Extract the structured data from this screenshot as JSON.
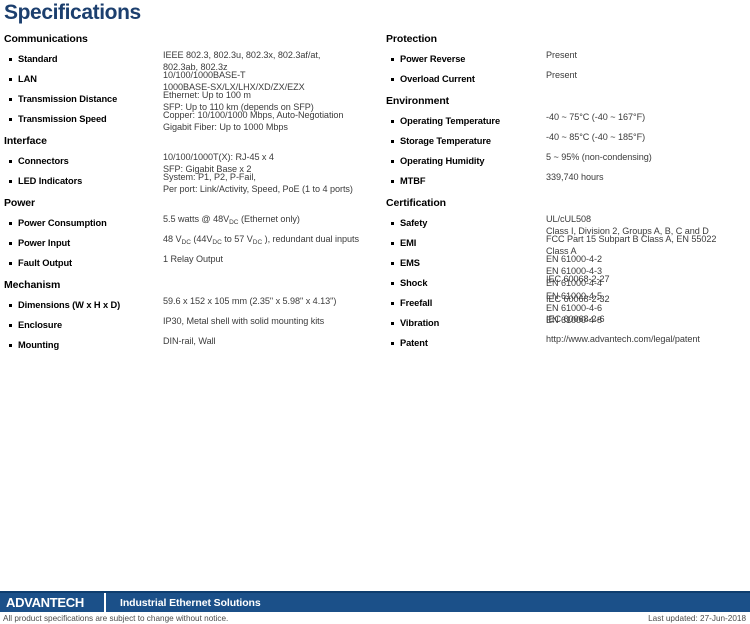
{
  "page": {
    "title": "Specifications"
  },
  "left_column": [
    {
      "title": "Communications",
      "rows": [
        {
          "label": "Standard",
          "value": "IEEE 802.3, 802.3u, 802.3x, 802.3af/at,\n802.3ab, 802.3z"
        },
        {
          "label": "LAN",
          "value": "10/100/1000BASE-T\n1000BASE-SX/LX/LHX/XD/ZX/EZX"
        },
        {
          "label": "Transmission Distance",
          "value": "Ethernet: Up to 100 m\nSFP: Up to 110 km (depends on SFP)"
        },
        {
          "label": "Transmission Speed",
          "value": "Copper: 10/100/1000 Mbps, Auto-Negotiation\nGigabit Fiber: Up to 1000 Mbps"
        }
      ]
    },
    {
      "title": "Interface",
      "rows": [
        {
          "label": "Connectors",
          "value": "10/100/1000T(X): RJ-45 x 4\nSFP: Gigabit Base x 2"
        },
        {
          "label": "LED Indicators",
          "value": "System: P1, P2, P-Fail,\nPer port: Link/Activity, Speed, PoE (1 to 4 ports)"
        }
      ]
    },
    {
      "title": "Power",
      "rows": [
        {
          "label": "Power Consumption",
          "value_html": "5.5 watts @ 48V<sub>DC</sub>  (Ethernet only)"
        },
        {
          "label": "Power Input",
          "value_html": "48 V<sub>DC</sub> (44V<sub>DC</sub> to 57 V<sub>DC</sub> ), redundant dual inputs"
        },
        {
          "label": "Fault Output",
          "value": "1 Relay Output"
        }
      ]
    },
    {
      "title": "Mechanism",
      "rows": [
        {
          "label": "Dimensions (W x H x D)",
          "value": "59.6 x 152 x 105 mm (2.35\" x 5.98\" x 4.13\")"
        },
        {
          "label": "Enclosure",
          "value": "IP30, Metal shell with solid mounting kits"
        },
        {
          "label": "Mounting",
          "value": "DIN-rail, Wall"
        }
      ]
    }
  ],
  "right_column": [
    {
      "title": "Protection",
      "rows": [
        {
          "label": "Power Reverse",
          "value": "Present"
        },
        {
          "label": "Overload Current",
          "value": "Present"
        }
      ]
    },
    {
      "title": "Environment",
      "rows": [
        {
          "label": "Operating Temperature",
          "value": "-40 ~ 75°C  (-40 ~ 167°F)"
        },
        {
          "label": "Storage Temperature",
          "value": "-40 ~ 85°C  (-40 ~ 185°F)"
        },
        {
          "label": "Operating Humidity",
          "value": "5 ~ 95% (non-condensing)"
        },
        {
          "label": "MTBF",
          "value": "339,740 hours"
        }
      ]
    },
    {
      "title": "Certification",
      "rows": [
        {
          "label": "Safety",
          "value": "UL/cUL508\nClass I, Division 2, Groups A, B, C and D"
        },
        {
          "label": "EMI",
          "value": "FCC Part 15 Subpart B Class A,  EN 55022\nClass A"
        },
        {
          "label": "EMS",
          "value": "EN 61000-4-2\nEN 61000-4-3\nEN 61000-4-4\nEN 61000-4-5\nEN 61000-4-6\nEN 61000-4-8"
        },
        {
          "label": "Shock",
          "value": "IEC 60068-2-27"
        },
        {
          "label": "Freefall",
          "value": "IEC 60068-2-32"
        },
        {
          "label": "Vibration",
          "value": "IEC 60068-2-6"
        },
        {
          "label": "Patent",
          "value": "http://www.advantech.com/legal/patent"
        }
      ]
    }
  ],
  "footer": {
    "logo": "ADVANTECH",
    "tagline": "Industrial Ethernet Solutions",
    "note": "All product specifications are subject to change without notice.",
    "updated": "Last updated: 27-Jun-2018",
    "bar_color": "#1b5089",
    "rule_color": "#0e3d6e"
  }
}
